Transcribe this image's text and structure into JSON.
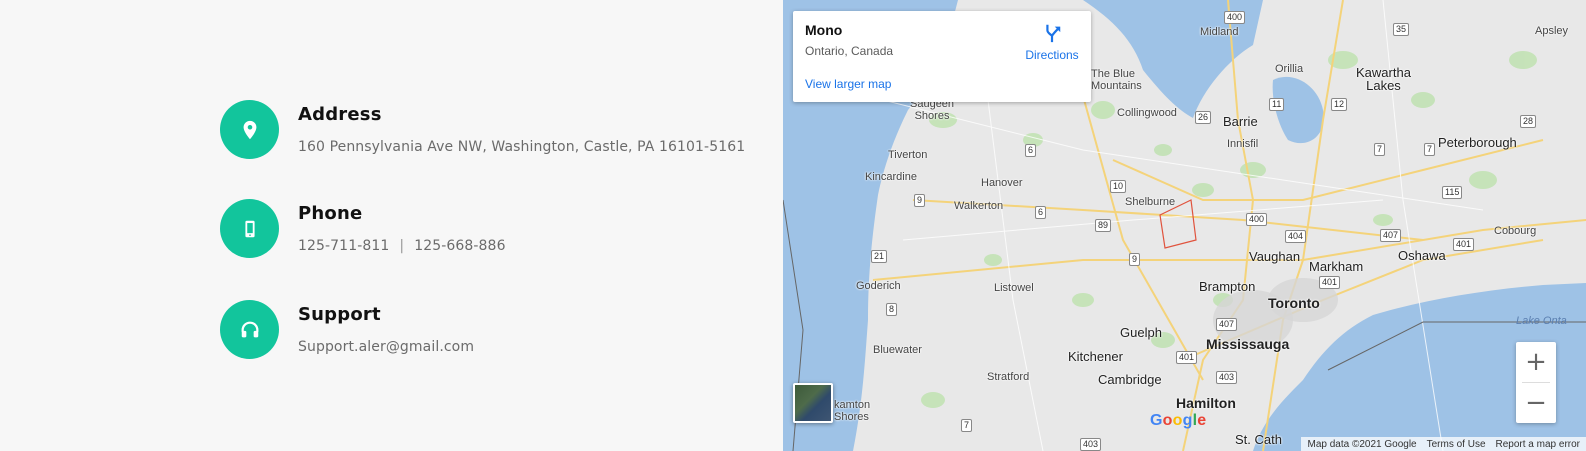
{
  "contact": {
    "address": {
      "title": "Address",
      "value": "160 Pennsylvania Ave NW, Washington, Castle, PA 16101-5161"
    },
    "phone": {
      "title": "Phone",
      "value1": "125-711-811",
      "separator": "|",
      "value2": "125-668-886"
    },
    "support": {
      "title": "Support",
      "value": "Support.aler@gmail.com"
    }
  },
  "map": {
    "card": {
      "title": "Mono",
      "subtitle": "Ontario, Canada",
      "link": "View larger map",
      "directions": "Directions"
    },
    "zoom_in": "+",
    "zoom_out": "−",
    "attribution": {
      "data": "Map data ©2021 Google",
      "terms": "Terms of Use",
      "report": "Report a map error"
    },
    "logo": [
      "G",
      "o",
      "o",
      "g",
      "l",
      "e"
    ],
    "places": {
      "midland": "Midland",
      "apsley": "Apsley",
      "the_blue_mountains": "The Blue\nMountains",
      "orillia": "Orillia",
      "kawartha": "Kawartha\nLakes",
      "saugeen": "Saugeen\nShores",
      "collingwood": "Collingwood",
      "barrie": "Barrie",
      "innisfil": "Innisfil",
      "peterborough": "Peterborough",
      "tiverton": "Tiverton",
      "kincardine": "Kincardine",
      "hanover": "Hanover",
      "walkerton": "Walkerton",
      "shelburne": "Shelburne",
      "vaughan": "Vaughan",
      "markham": "Markham",
      "oshawa": "Oshawa",
      "cobourg": "Cobourg",
      "brampton": "Brampton",
      "toronto": "Toronto",
      "goderich": "Goderich",
      "listowel": "Listowel",
      "guelph": "Guelph",
      "mississauga": "Mississauga",
      "lake_ontario": "Lake Onta",
      "bluewater": "Bluewater",
      "kitchener": "Kitchener",
      "stratford": "Stratford",
      "cambridge": "Cambridge",
      "hamilton": "Hamilton",
      "kamton": "kamton\nShores",
      "st_cath": "St. Cath"
    },
    "shields": [
      "400",
      "35",
      "28",
      "11",
      "12",
      "26",
      "7",
      "7",
      "6",
      "10",
      "400",
      "115",
      "9",
      "6",
      "89",
      "404",
      "407",
      "401",
      "21",
      "9",
      "401",
      "8",
      "407",
      "401",
      "403",
      "7",
      "403"
    ]
  },
  "colors": {
    "accent": "#12c59c",
    "text_dark": "#111111",
    "text_muted": "#6b6b6b",
    "panel_bg": "#f7f7f7",
    "map_land": "#e8e8e8",
    "map_water": "#9ec2e6",
    "map_park": "#c2e2b4",
    "link_blue": "#1a73e8"
  },
  "icons": [
    "location-pin-icon",
    "smartphone-icon",
    "headphones-icon",
    "directions-icon"
  ]
}
